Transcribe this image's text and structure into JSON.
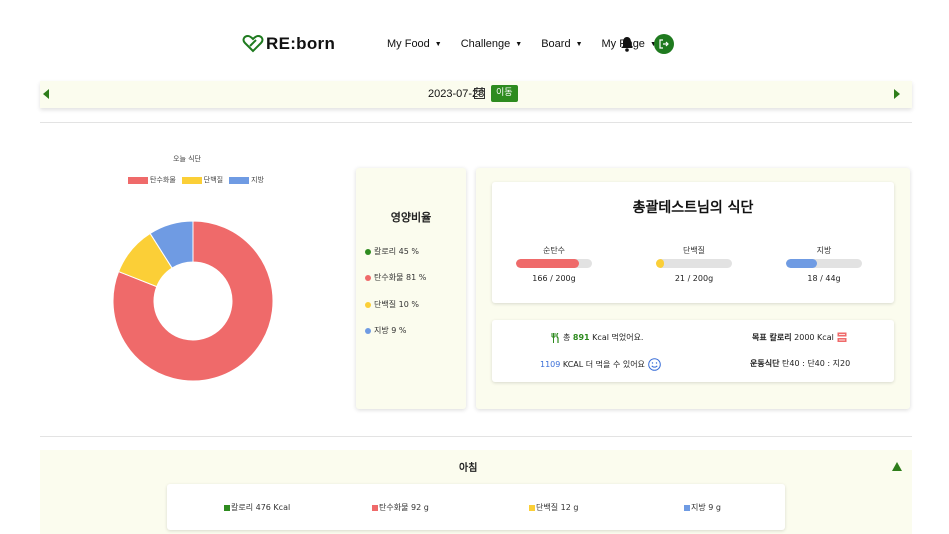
{
  "app": {
    "logo_text": "RE:born",
    "nav": [
      {
        "label": "My Food"
      },
      {
        "label": "Challenge"
      },
      {
        "label": "Board"
      },
      {
        "label": "My Page"
      }
    ]
  },
  "date_bar": {
    "date": "2023-07-28",
    "move_button": "이동"
  },
  "chart_data": {
    "type": "doughnut",
    "title": "오늘 식단",
    "legend_position": "top",
    "series": [
      {
        "name": "탄수화물",
        "value": 81,
        "color": "#ef6a6a"
      },
      {
        "name": "단백질",
        "value": 10,
        "color": "#fbcf37"
      },
      {
        "name": "지방",
        "value": 9,
        "color": "#6f9be3"
      }
    ]
  },
  "ratio": {
    "title": "영양비율",
    "items": [
      {
        "label": "칼로리 45 %",
        "color": "#2e8b1f"
      },
      {
        "label": "탄수화물 81 %",
        "color": "#ef6a6a"
      },
      {
        "label": "단백질 10 %",
        "color": "#fbcf37"
      },
      {
        "label": "지방 9 %",
        "color": "#6f9be3"
      }
    ]
  },
  "summary": {
    "title": "총괄테스트님의 식단",
    "macros": [
      {
        "name": "순탄수",
        "value": "166 / 200g",
        "fraction": 0.83,
        "color": "#ef6a6a"
      },
      {
        "name": "단백질",
        "value": "21 / 200g",
        "fraction": 0.105,
        "color": "#fbcf37"
      },
      {
        "name": "지방",
        "value": "18 / 44g",
        "fraction": 0.41,
        "color": "#6f9be3"
      }
    ],
    "eaten_prefix": "총",
    "eaten_kcal": "891",
    "eaten_suffix": "Kcal 먹었어요.",
    "remain_kcal": "1109",
    "remain_suffix": "KCAL 더 먹을 수 있어요",
    "goal_label": "목표 칼로리",
    "goal_value": "2000 Kcal",
    "diet_label": "운동식단",
    "diet_value": "탄40 : 단40 : 지20"
  },
  "breakfast": {
    "title": "아침",
    "items": [
      {
        "label": "칼로리 476 Kcal",
        "color": "#2e8b1f"
      },
      {
        "label": "탄수화물 92 g",
        "color": "#ef6a6a"
      },
      {
        "label": "단백질 12 g",
        "color": "#fbcf37"
      },
      {
        "label": "지방 9 g",
        "color": "#6f9be3"
      }
    ]
  }
}
